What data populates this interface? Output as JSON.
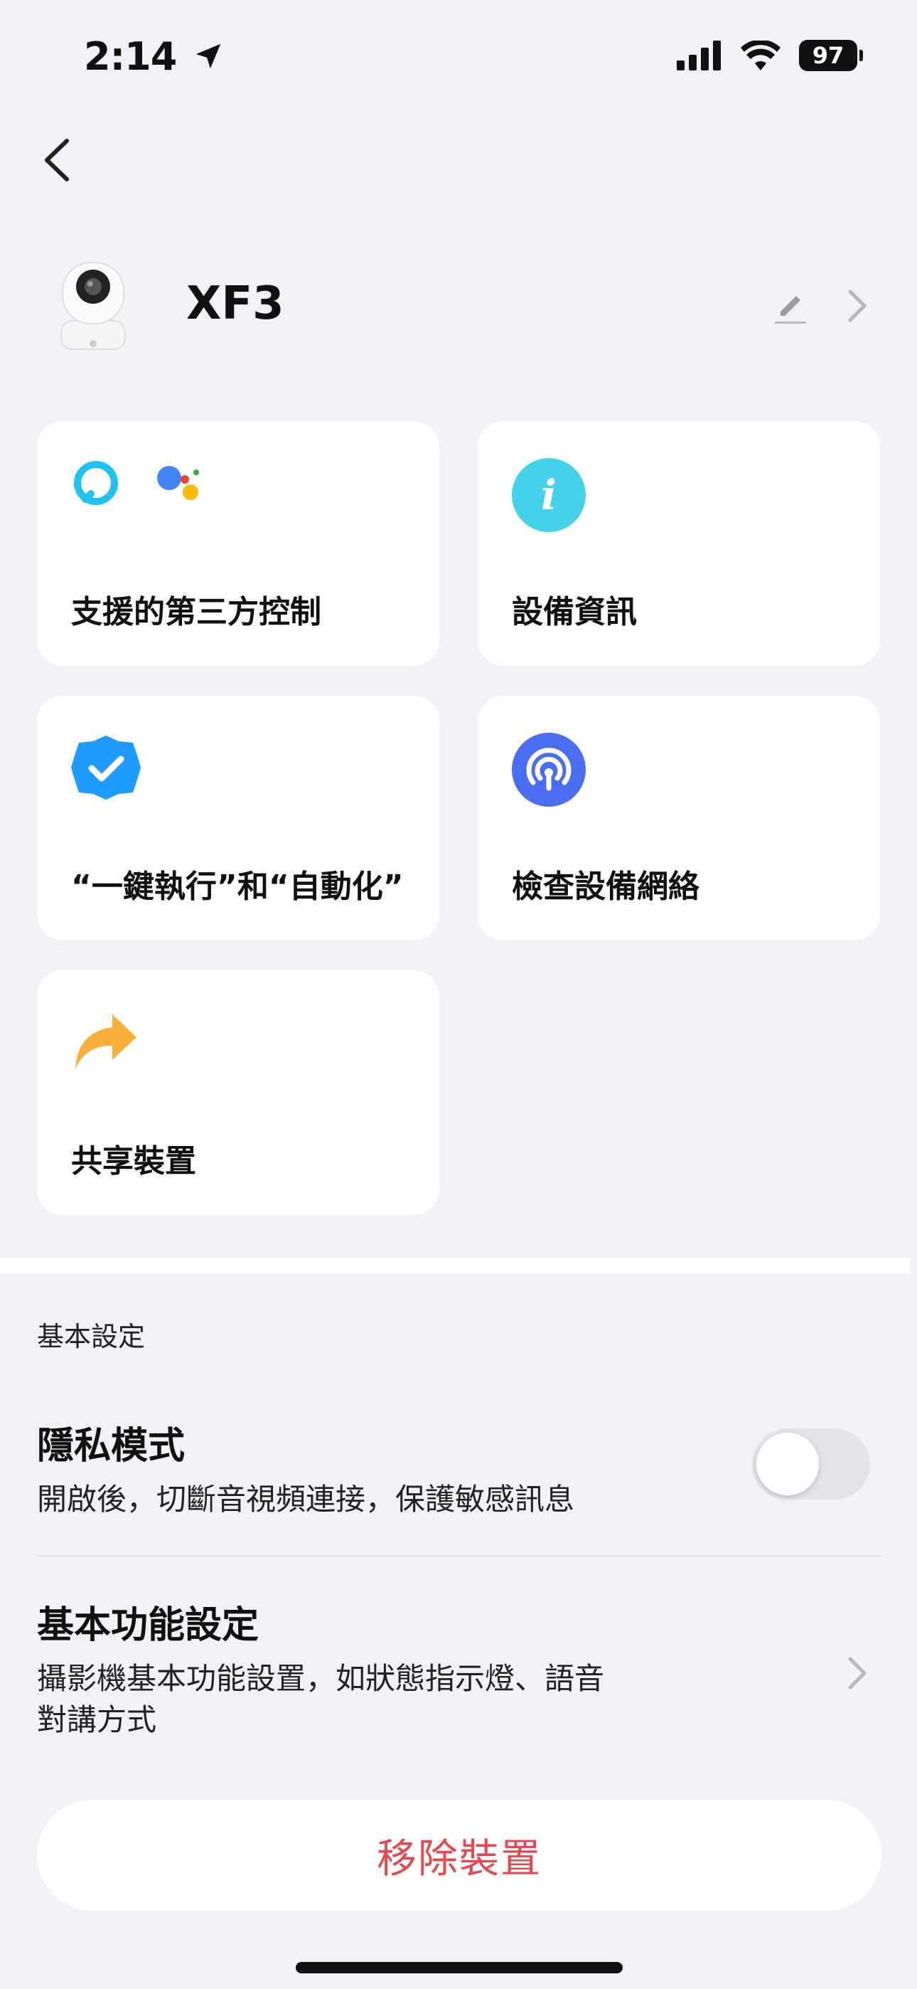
{
  "status_bar": {
    "time": "2:14",
    "battery": "97"
  },
  "device": {
    "name": "XF3"
  },
  "cards": [
    {
      "label": "支援的第三方控制"
    },
    {
      "label": "設備資訊"
    },
    {
      "label": "“一鍵執行”和“自動化”"
    },
    {
      "label": "檢查設備網絡"
    },
    {
      "label": "共享裝置"
    }
  ],
  "basic_settings": {
    "section_title": "基本設定",
    "privacy": {
      "title": "隱私模式",
      "subtitle": "開啟後，切斷音視頻連接，保護敏感訊息",
      "enabled": false
    },
    "function": {
      "title": "基本功能設定",
      "subtitle_line1": "攝影機基本功能設置，如狀態指示燈、語音",
      "subtitle_line2": "對講方式"
    }
  },
  "remove_button": "移除裝置",
  "colors": {
    "background": "#f2f1f6",
    "danger": "#e5484d",
    "accent_blue": "#1f9bff"
  }
}
